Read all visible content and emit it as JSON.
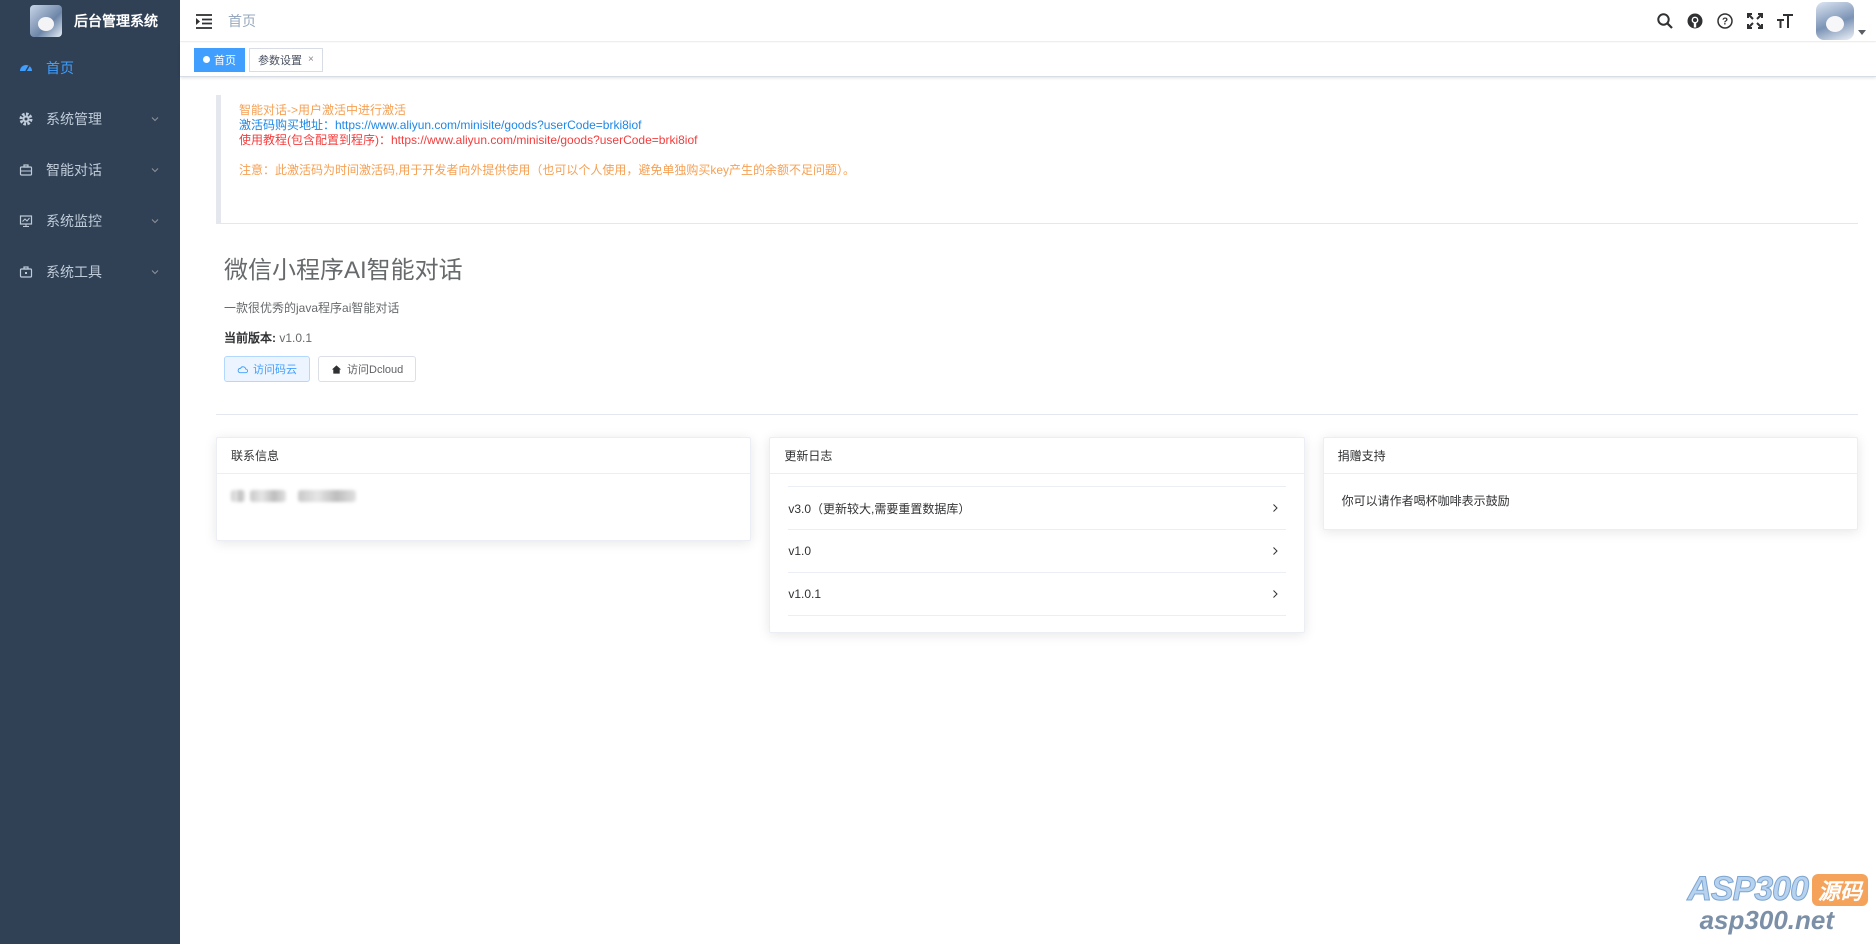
{
  "app": {
    "title": "后台管理系统"
  },
  "sidebar": {
    "items": [
      {
        "label": "首页",
        "icon": "dashboard-icon",
        "active": true
      },
      {
        "label": "系统管理",
        "icon": "gear-icon"
      },
      {
        "label": "智能对话",
        "icon": "briefcase-icon"
      },
      {
        "label": "系统监控",
        "icon": "monitor-icon"
      },
      {
        "label": "系统工具",
        "icon": "toolbox-icon"
      }
    ]
  },
  "navbar": {
    "breadcrumb": "首页"
  },
  "tags": {
    "home": "首页",
    "params": "参数设置",
    "close": "×"
  },
  "notice": {
    "line1": "智能对话->用户激活中进行激活",
    "line2": "激活码购买地址：https://www.aliyun.com/minisite/goods?userCode=brki8iof",
    "line3": "使用教程(包含配置到程序)：https://www.aliyun.com/minisite/goods?userCode=brki8iof",
    "line4": "注意：此激活码为时间激活码,用于开发者向外提供使用（也可以个人使用，避免单独购买key产生的余额不足问题）。"
  },
  "intro": {
    "title": "微信小程序AI智能对话",
    "desc": "一款很优秀的java程序ai智能对话",
    "version_label": "当前版本:",
    "version": "v1.0.1",
    "btn_gitee": "访问码云",
    "btn_dcloud": "访问Dcloud"
  },
  "cards": {
    "contact": {
      "title": "联系信息"
    },
    "changelog": {
      "title": "更新日志",
      "items": [
        "v3.0（更新较大,需要重置数据库）",
        "v1.0",
        "v1.0.1"
      ]
    },
    "donate": {
      "title": "捐赠支持",
      "text": "你可以请作者喝杯咖啡表示鼓励"
    }
  },
  "watermark": {
    "brand": "ASP300",
    "tag": "源码",
    "url": "asp300.net"
  },
  "colors": {
    "sidebar_bg": "#304156",
    "accent": "#409eff",
    "orange": "#f6a053",
    "red": "#f33d3d"
  }
}
